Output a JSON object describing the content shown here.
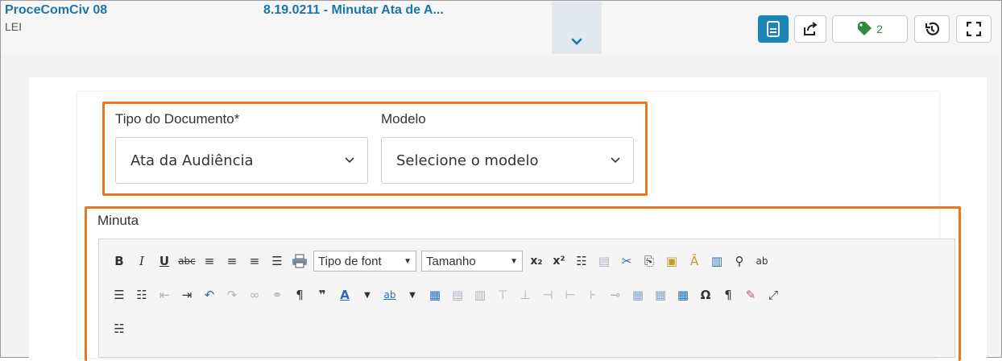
{
  "header": {
    "process_title": "ProceComCiv 08",
    "process_sub": "LEI",
    "task_title": "8.19.0211 - Minutar Ata de A...",
    "tag_count": "2"
  },
  "form": {
    "tipo_label": "Tipo do Documento*",
    "tipo_value": "Ata da Audiência",
    "modelo_label": "Modelo",
    "modelo_value": "Selecione o modelo",
    "minuta_label": "Minuta"
  },
  "editor": {
    "font_dropdown": "Tipo de font",
    "size_dropdown": "Tamanho"
  },
  "colors": {
    "accent": "#1a85b6",
    "highlight": "#e87722",
    "link": "#1c75a8",
    "tag": "#2f8a3d"
  }
}
